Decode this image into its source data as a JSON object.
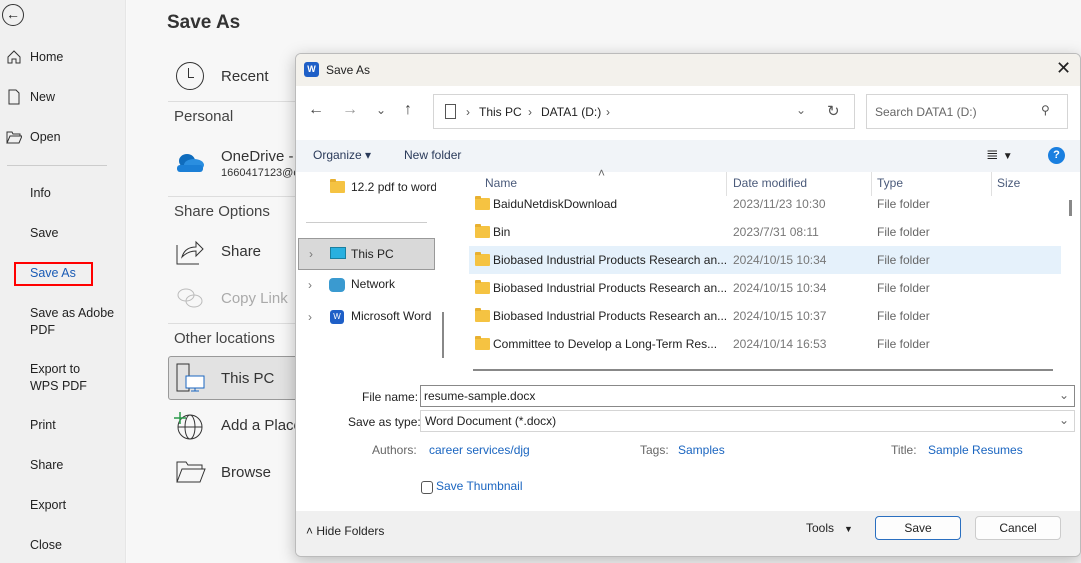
{
  "backstage": {
    "nav": {
      "home": "Home",
      "new": "New",
      "open": "Open",
      "info": "Info",
      "save": "Save",
      "save_as": "Save As",
      "save_adobe": "Save as Adobe PDF",
      "export_wps": "Export to WPS PDF",
      "print": "Print",
      "share": "Share",
      "export": "Export",
      "close": "Close"
    },
    "title": "Save As",
    "recent": "Recent",
    "personal": "Personal",
    "onedrive": "OneDrive -",
    "onedrive_account": "1660417123@c",
    "share_options": "Share Options",
    "share": "Share",
    "copy_link": "Copy Link",
    "other_locations": "Other locations",
    "this_pc": "This PC",
    "add_place": "Add a Place",
    "browse": "Browse"
  },
  "dialog": {
    "title": "Save As",
    "breadcrumb": [
      "This PC",
      "DATA1 (D:)"
    ],
    "search_placeholder": "Search DATA1 (D:)",
    "organize": "Organize",
    "new_folder": "New folder",
    "tree": [
      {
        "label": "12.2 pdf to word"
      },
      {
        "label": "This PC"
      },
      {
        "label": "Network"
      },
      {
        "label": "Microsoft Word"
      }
    ],
    "columns": [
      "Name",
      "Date modified",
      "Type",
      "Size"
    ],
    "files": [
      {
        "name": "BaiduNetdiskDownload",
        "date": "2023/11/23 10:30",
        "type": "File folder"
      },
      {
        "name": "Bin",
        "date": "2023/7/31 08:11",
        "type": "File folder"
      },
      {
        "name": "Biobased Industrial Products Research an...",
        "date": "2024/10/15 10:34",
        "type": "File folder"
      },
      {
        "name": "Biobased Industrial Products Research an...",
        "date": "2024/10/15 10:34",
        "type": "File folder"
      },
      {
        "name": "Biobased Industrial Products Research an...",
        "date": "2024/10/15 10:37",
        "type": "File folder"
      },
      {
        "name": "Committee to Develop a Long-Term Res...",
        "date": "2024/10/14 16:53",
        "type": "File folder"
      }
    ],
    "file_name_label": "File name:",
    "file_name": "resume-sample.docx",
    "save_type_label": "Save as type:",
    "save_type": "Word Document (*.docx)",
    "authors_label": "Authors:",
    "authors": "career services/djg",
    "tags_label": "Tags:",
    "tags": "Samples",
    "title_label": "Title:",
    "title_value": "Sample Resumes",
    "thumbnail": "Save Thumbnail",
    "hide_folders": "Hide Folders",
    "tools": "Tools",
    "save": "Save",
    "cancel": "Cancel"
  },
  "colors": {
    "accent": "#1a65c0",
    "highlight": "#ff0000",
    "selected_row": "#e5f1fb"
  }
}
